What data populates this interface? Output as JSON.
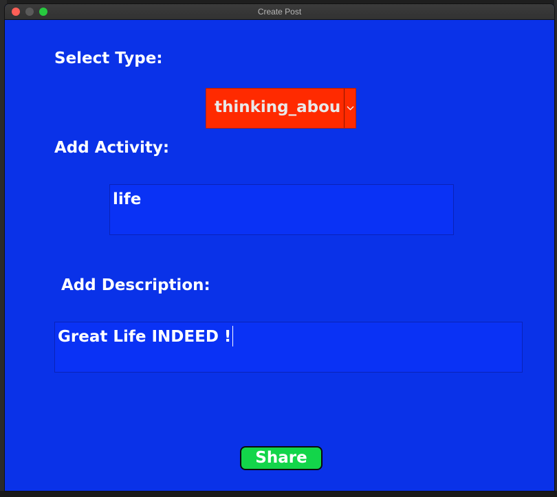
{
  "window": {
    "title": "Create Post"
  },
  "form": {
    "type_label": "Select Type:",
    "type_value": "thinking_about",
    "activity_label": "Add Activity:",
    "activity_value": "life",
    "description_label": "Add Description:",
    "description_value": "Great Life INDEED !",
    "share_label": "Share"
  },
  "colors": {
    "background": "#0a32e8",
    "select_bg": "#ff2a00",
    "share_bg": "#13d54a"
  },
  "icons": {
    "select_arrow": "chevron-down-icon"
  }
}
